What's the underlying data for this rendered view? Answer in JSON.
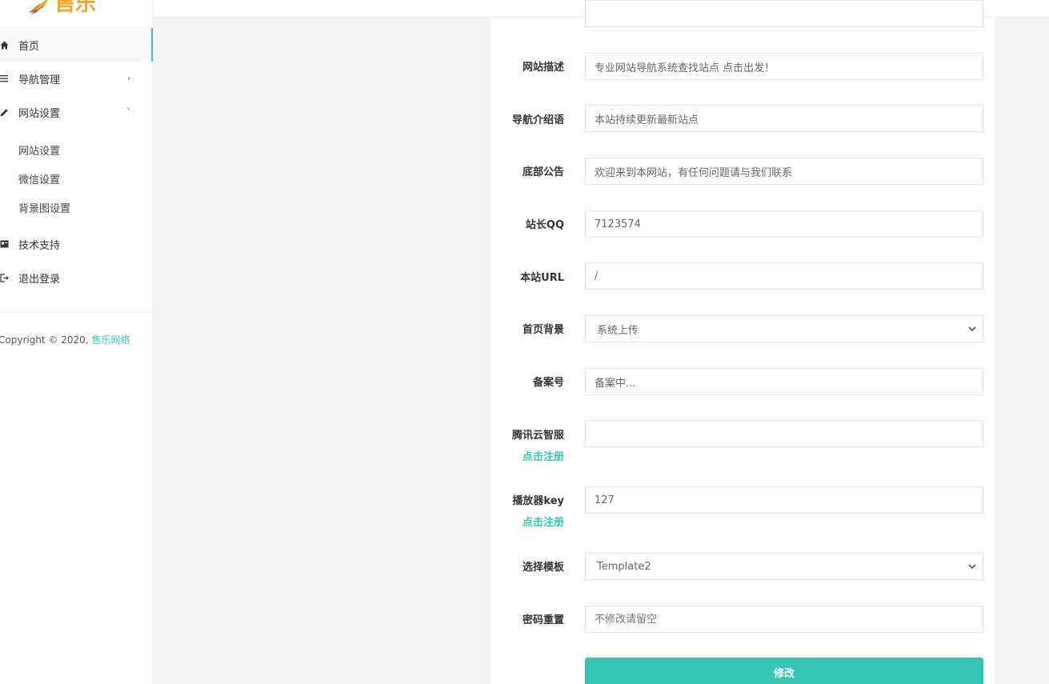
{
  "logo": {
    "text": "售乐"
  },
  "sidebar": {
    "items": [
      {
        "label": "首页",
        "icon": "home-icon"
      },
      {
        "label": "导航管理",
        "icon": "list-icon",
        "arrow": "›"
      },
      {
        "label": "网站设置",
        "icon": "edit-icon",
        "arrow": "ˇ"
      },
      {
        "label": "技术支持",
        "icon": "card-icon"
      },
      {
        "label": "退出登录",
        "icon": "logout-icon"
      }
    ],
    "subitems": [
      {
        "label": "网站设置"
      },
      {
        "label": "微信设置"
      },
      {
        "label": "背景图设置"
      }
    ],
    "copyright": {
      "text": "Copyright © 2020, ",
      "link": "售乐网络"
    }
  },
  "form": {
    "top_cut_value": "",
    "rows": [
      {
        "label": "网站描述",
        "value": "专业网站导航系统查找站点 点击出发！"
      },
      {
        "label": "导航介绍语",
        "value": "本站持续更新最新站点"
      },
      {
        "label": "底部公告",
        "value": "欢迎来到本网站，有任何问题请与我们联系"
      },
      {
        "label": "站长QQ",
        "value": "7123574"
      },
      {
        "label": "本站URL",
        "value": "/"
      },
      {
        "label": "首页背景",
        "value": "系统上传"
      },
      {
        "label": "备案号",
        "value": "备案中..."
      },
      {
        "label": "腾讯云智服",
        "value": "",
        "link": "点击注册"
      },
      {
        "label": "播放器key",
        "value": "127",
        "link": "点击注册"
      },
      {
        "label": "选择模板",
        "value": "Template2"
      },
      {
        "label": "密码重置",
        "placeholder": "不修改请留空"
      }
    ],
    "submit_label": "修改"
  },
  "colors": {
    "accent": "#35c5b5",
    "logo": "#f5a623"
  }
}
